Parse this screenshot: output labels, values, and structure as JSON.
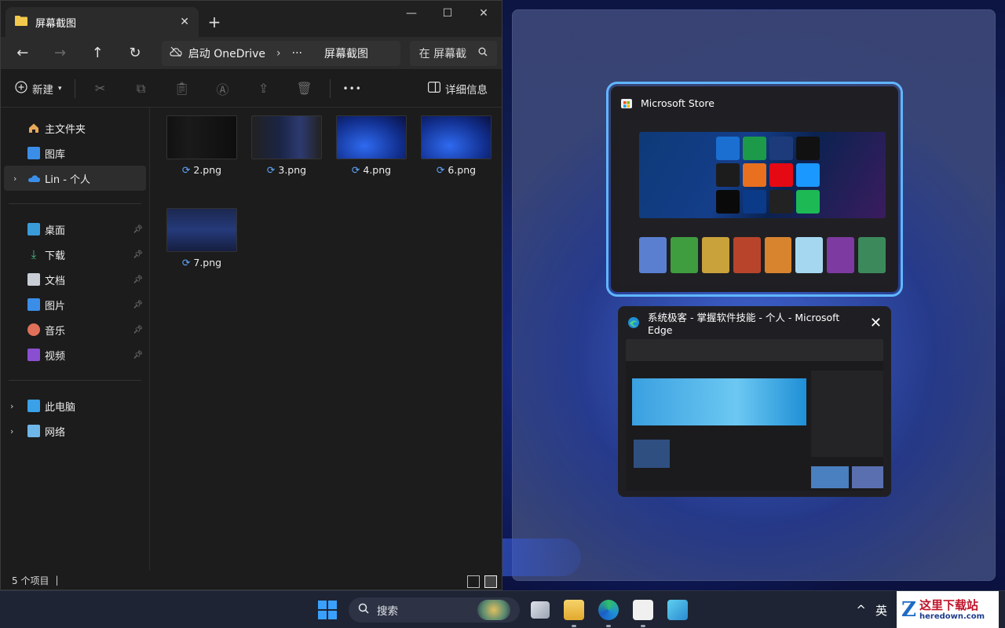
{
  "explorer": {
    "tab_title": "屏幕截图",
    "tab_close": "✕",
    "new_tab": "+",
    "window_controls": {
      "minimize": "—",
      "maximize": "☐",
      "close": "✕"
    },
    "nav": {
      "back": "←",
      "forward": "→",
      "up": "↑",
      "refresh": "↻"
    },
    "address": {
      "cloud_label": "启动 OneDrive",
      "chevron": "›",
      "more": "···",
      "current": "屏幕截图"
    },
    "search_placeholder": "在 屏幕截",
    "toolbar": {
      "new_label": "新建",
      "more": "•••",
      "details_label": "详细信息"
    },
    "sidebar": {
      "group1": [
        {
          "label": "主文件夹",
          "icon": "home-icon"
        },
        {
          "label": "图库",
          "icon": "gallery-icon"
        },
        {
          "label": "Lin - 个人",
          "icon": "onedrive-icon"
        }
      ],
      "group2": [
        {
          "label": "桌面",
          "icon": "desktop-icon"
        },
        {
          "label": "下载",
          "icon": "download-icon"
        },
        {
          "label": "文档",
          "icon": "documents-icon"
        },
        {
          "label": "图片",
          "icon": "pictures-icon"
        },
        {
          "label": "音乐",
          "icon": "music-icon"
        },
        {
          "label": "视频",
          "icon": "videos-icon"
        }
      ],
      "group3": [
        {
          "label": "此电脑",
          "icon": "this-pc-icon"
        },
        {
          "label": "网络",
          "icon": "network-icon"
        }
      ]
    },
    "files": [
      "2.png",
      "3.png",
      "4.png",
      "6.png",
      "7.png"
    ],
    "status": "5 个项目"
  },
  "snap": {
    "card1_title": "Microsoft Store",
    "card2_title": "系统极客 - 掌握软件技能 - 个人 - Microsoft Edge",
    "card2_close": "✕"
  },
  "taskbar": {
    "search_label": "搜索",
    "tray_chevron": "^",
    "ime": "英",
    "watermark_cn": "这里下载站",
    "watermark_en": "heredown.com"
  },
  "colors": {
    "accent": "#60b6ff",
    "folder": "#f2c94c",
    "onedrive": "#3b8ee8"
  }
}
